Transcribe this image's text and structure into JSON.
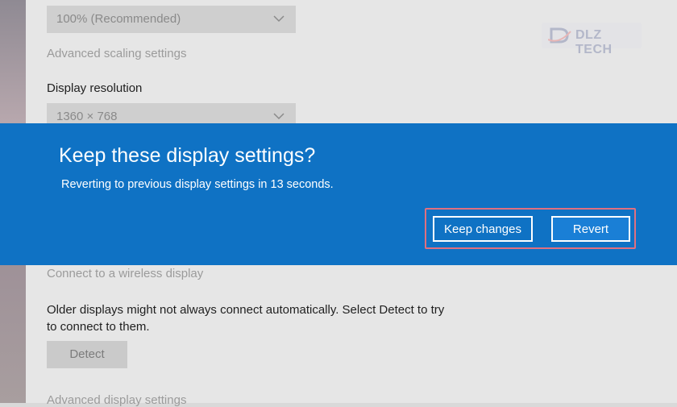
{
  "settings": {
    "scale_dropdown_value": "100% (Recommended)",
    "advanced_scaling_link": "Advanced scaling settings",
    "display_resolution_label": "Display resolution",
    "resolution_dropdown_value": "1360 × 768",
    "wireless_display_link": "Connect to a wireless display",
    "older_displays_text": "Older displays might not always connect automatically. Select Detect to try to connect to them.",
    "detect_button": "Detect",
    "advanced_display_link": "Advanced display settings"
  },
  "watermark": {
    "text": "DLZ TECH"
  },
  "dialog": {
    "title": "Keep these display settings?",
    "message": "Reverting to previous display settings in 13 seconds.",
    "keep_button": "Keep changes",
    "revert_button": "Revert"
  },
  "colors": {
    "dialog_bg": "#0f72c4",
    "highlight_border": "#e07080",
    "revert_bg": "#1a7fd6"
  }
}
